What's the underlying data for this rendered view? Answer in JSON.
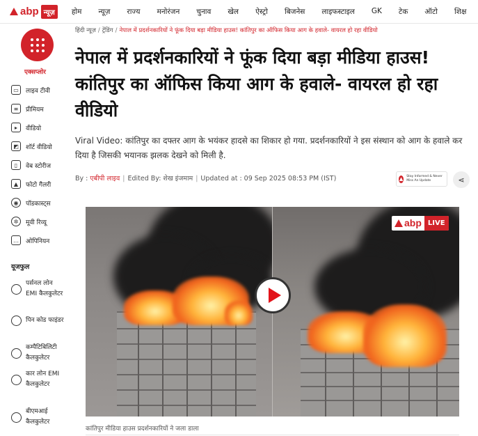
{
  "brand": {
    "logo_text": "abp",
    "logo_badge": "न्यूज़"
  },
  "nav": [
    "होम",
    "न्यूज़",
    "राज्य",
    "मनोरंजन",
    "चुनाव",
    "खेल",
    "ऐस्ट्रो",
    "बिजनेस",
    "लाइफस्टाइल",
    "GK",
    "टेक",
    "ऑटो",
    "शिक्ष"
  ],
  "sidebar": {
    "explore_label": "एक्सप्लोर",
    "items": [
      "लाइव टीवी",
      "प्रीमियम",
      "वीडियो",
      "शॉर्ट वीडियो",
      "वेब स्टोरीज",
      "फोटो गैलरी",
      "पॉडकास्ट्स",
      "मूवी रिव्यू",
      "ओपिनियन"
    ],
    "section_title": "यूजफुल",
    "calculators": [
      "पर्सनल लोन EMI कैलकुलेटर",
      "पिन कोड फाइंडर",
      "कम्पैटिबिलिटी कैलकुलेटर",
      "कार लोन EMI कैलकुलेटर",
      "बीएमआई कैलकुलेटर"
    ]
  },
  "breadcrumb": {
    "home": "हिंदी न्यूज़",
    "section": "ट्रेंडिंग",
    "current": "नेपाल में प्रदर्शनकारियों ने फूंक दिया बड़ा मीडिया हाउस! कांतिपुर का ऑफिस किया आग के हवाले- वायरल हो रहा वीडियो"
  },
  "article": {
    "headline": "नेपाल में प्रदर्शनकारियों ने फूंक दिया बड़ा मीडिया हाउस! कांतिपुर का ऑफिस किया आग के हवाले- वायरल हो रहा वीडियो",
    "subhead": "Viral Video: कांतिपुर का दफ्तर आग के भयंकर हादसे का शिकार हो गया. प्रदर्शनकारियों ने इस संस्थान को आग के हवाले कर दिया है जिसकी भयानक झलक देखने को मिली है.",
    "by_prefix": "By : ",
    "author": "एबीपी लाइव",
    "edited": "Edited By: शेख इंजमाम",
    "updated": "Updated at : 09 Sep 2025 08:53 PM (IST)",
    "stay_informed": "Stay Informed & Never Miss An Update"
  },
  "video": {
    "badge_brand": "abp",
    "badge_live": "LIVE",
    "caption": "कांतिपुर मीडिया हाउस प्रदर्शनकारियों ने जला डाला"
  },
  "colors": {
    "brand_red": "#d2232a"
  }
}
